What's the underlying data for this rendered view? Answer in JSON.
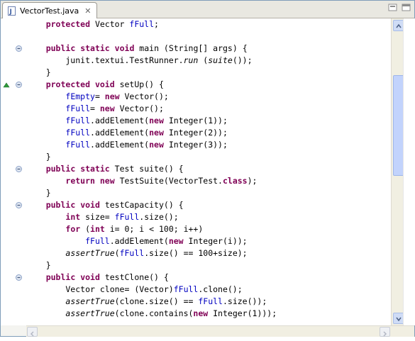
{
  "tab": {
    "title": "VectorTest.java",
    "close_glyph": "✕"
  },
  "code_lines": [
    [
      [
        "    ",
        ""
      ],
      [
        "protected",
        "kw"
      ],
      [
        " Vector ",
        ""
      ],
      [
        "fFull",
        "fld"
      ],
      [
        ";",
        ""
      ]
    ],
    [
      [
        "",
        ""
      ]
    ],
    [
      [
        "    ",
        ""
      ],
      [
        "public",
        "kw"
      ],
      [
        " ",
        ""
      ],
      [
        "static",
        "kw"
      ],
      [
        " ",
        ""
      ],
      [
        "void",
        "kw"
      ],
      [
        " main (String[] args) {",
        ""
      ]
    ],
    [
      [
        "        junit.textui.TestRunner.",
        ""
      ],
      [
        "run",
        "it"
      ],
      [
        " (",
        ""
      ],
      [
        "suite",
        "it"
      ],
      [
        "());",
        ""
      ]
    ],
    [
      [
        "    }",
        ""
      ]
    ],
    [
      [
        "    ",
        ""
      ],
      [
        "protected",
        "kw"
      ],
      [
        " ",
        ""
      ],
      [
        "void",
        "kw"
      ],
      [
        " setUp() {",
        ""
      ]
    ],
    [
      [
        "        ",
        ""
      ],
      [
        "fEmpty",
        "fld"
      ],
      [
        "= ",
        ""
      ],
      [
        "new",
        "kw"
      ],
      [
        " Vector();",
        ""
      ]
    ],
    [
      [
        "        ",
        ""
      ],
      [
        "fFull",
        "fld"
      ],
      [
        "= ",
        ""
      ],
      [
        "new",
        "kw"
      ],
      [
        " Vector();",
        ""
      ]
    ],
    [
      [
        "        ",
        ""
      ],
      [
        "fFull",
        "fld"
      ],
      [
        ".addElement(",
        ""
      ],
      [
        "new",
        "kw"
      ],
      [
        " Integer(1));",
        ""
      ]
    ],
    [
      [
        "        ",
        ""
      ],
      [
        "fFull",
        "fld"
      ],
      [
        ".addElement(",
        ""
      ],
      [
        "new",
        "kw"
      ],
      [
        " Integer(2));",
        ""
      ]
    ],
    [
      [
        "        ",
        ""
      ],
      [
        "fFull",
        "fld"
      ],
      [
        ".addElement(",
        ""
      ],
      [
        "new",
        "kw"
      ],
      [
        " Integer(3));",
        ""
      ]
    ],
    [
      [
        "    }",
        ""
      ]
    ],
    [
      [
        "    ",
        ""
      ],
      [
        "public",
        "kw"
      ],
      [
        " ",
        ""
      ],
      [
        "static",
        "kw"
      ],
      [
        " Test suite() {",
        ""
      ]
    ],
    [
      [
        "        ",
        ""
      ],
      [
        "return",
        "kw"
      ],
      [
        " ",
        ""
      ],
      [
        "new",
        "kw"
      ],
      [
        " TestSuite(VectorTest.",
        ""
      ],
      [
        "class",
        "kw"
      ],
      [
        ");",
        ""
      ]
    ],
    [
      [
        "    }",
        ""
      ]
    ],
    [
      [
        "    ",
        ""
      ],
      [
        "public",
        "kw"
      ],
      [
        " ",
        ""
      ],
      [
        "void",
        "kw"
      ],
      [
        " testCapacity() {",
        ""
      ]
    ],
    [
      [
        "        ",
        ""
      ],
      [
        "int",
        "kw"
      ],
      [
        " size= ",
        ""
      ],
      [
        "fFull",
        "fld"
      ],
      [
        ".size();",
        ""
      ]
    ],
    [
      [
        "        ",
        ""
      ],
      [
        "for",
        "kw"
      ],
      [
        " (",
        ""
      ],
      [
        "int",
        "kw"
      ],
      [
        " i= 0; i < 100; i++)",
        ""
      ]
    ],
    [
      [
        "            ",
        ""
      ],
      [
        "fFull",
        "fld"
      ],
      [
        ".addElement(",
        ""
      ],
      [
        "new",
        "kw"
      ],
      [
        " Integer(i));",
        ""
      ]
    ],
    [
      [
        "        ",
        ""
      ],
      [
        "assertTrue",
        "it"
      ],
      [
        "(",
        ""
      ],
      [
        "fFull",
        "fld"
      ],
      [
        ".size() == 100+size);",
        ""
      ]
    ],
    [
      [
        "    }",
        ""
      ]
    ],
    [
      [
        "    ",
        ""
      ],
      [
        "public",
        "kw"
      ],
      [
        " ",
        ""
      ],
      [
        "void",
        "kw"
      ],
      [
        " testClone() {",
        ""
      ]
    ],
    [
      [
        "        Vector clone= (Vector)",
        ""
      ],
      [
        "fFull",
        "fld"
      ],
      [
        ".clone();",
        ""
      ]
    ],
    [
      [
        "        ",
        ""
      ],
      [
        "assertTrue",
        "it"
      ],
      [
        "(clone.size() == ",
        ""
      ],
      [
        "fFull",
        "fld"
      ],
      [
        ".size());",
        ""
      ]
    ],
    [
      [
        "        ",
        ""
      ],
      [
        "assertTrue",
        "it"
      ],
      [
        "(clone.contains(",
        ""
      ],
      [
        "new",
        "kw"
      ],
      [
        " Integer(1)));",
        ""
      ]
    ]
  ],
  "fold_marker_lines": [
    2,
    5,
    12,
    15,
    21
  ],
  "override_marker_lines": [
    5
  ],
  "colors": {
    "keyword": "#7f0055",
    "field": "#0000c0",
    "text": "#000000"
  }
}
